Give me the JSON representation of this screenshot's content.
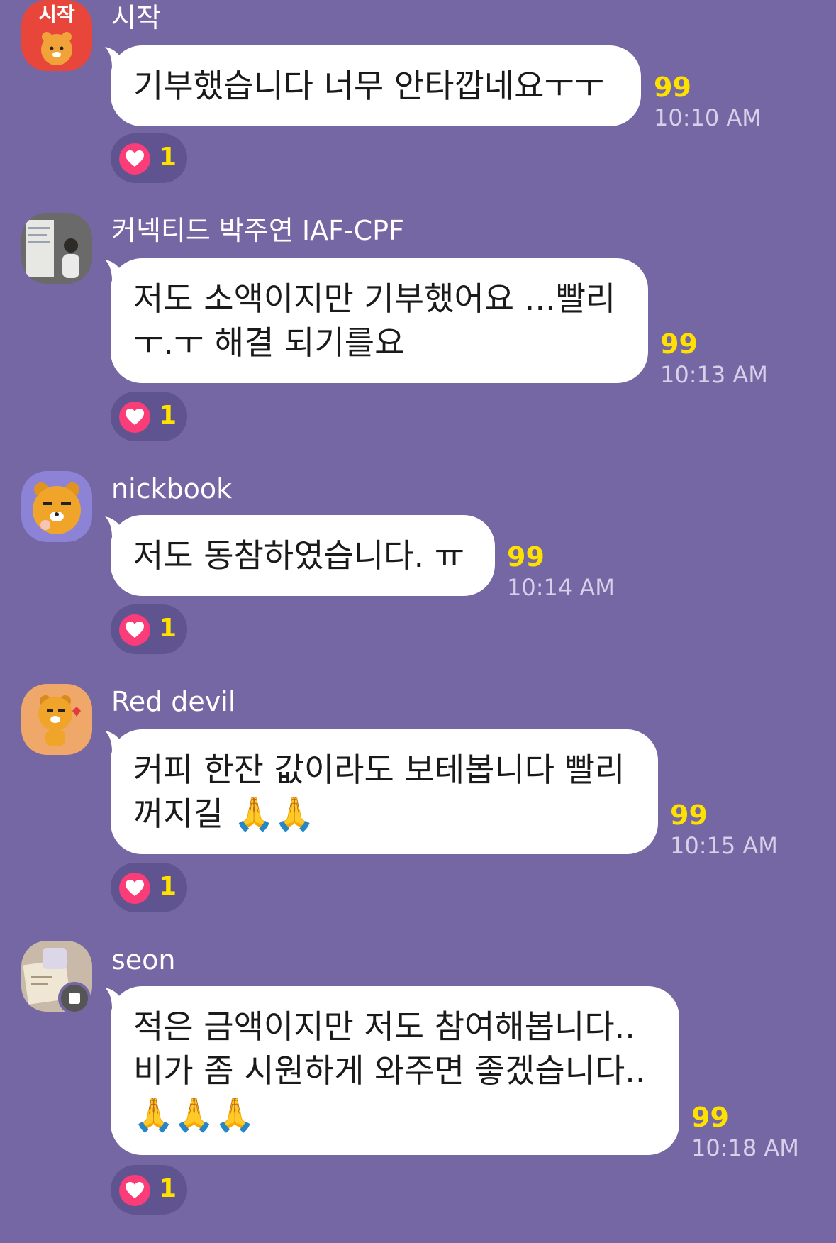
{
  "colors": {
    "background": "#7467a3",
    "bubble": "#ffffff",
    "unread": "#ffe100",
    "heart": "#fa3d78"
  },
  "messages": [
    {
      "sender": "시작",
      "avatar_text": "시작",
      "text": "기부했습니다 너무 안타깝네요ㅜㅜ",
      "unread": "99",
      "time": "10:10 AM",
      "reaction_icon": "heart-icon",
      "reaction_count": "1"
    },
    {
      "sender": "커넥티드 박주연 IAF-CPF",
      "text": "저도 소액이지만 기부했어요 ...빨리\nㅜ.ㅜ 해결 되기를요",
      "unread": "99",
      "time": "10:13 AM",
      "reaction_icon": "heart-icon",
      "reaction_count": "1"
    },
    {
      "sender": "nickbook",
      "text": "저도 동참하였습니다. ㅠ",
      "unread": "99",
      "time": "10:14 AM",
      "reaction_icon": "heart-icon",
      "reaction_count": "1"
    },
    {
      "sender": "Red devil",
      "text": "커피 한잔 값이라도 보테봅니다 빨리\n꺼지길 🙏🙏",
      "unread": "99",
      "time": "10:15 AM",
      "reaction_icon": "heart-icon",
      "reaction_count": "1"
    },
    {
      "sender": "seon",
      "text": "적은 금액이지만 저도 참여해봅니다..\n비가 좀 시원하게 와주면 좋겠습니다..\n🙏🙏🙏",
      "unread": "99",
      "time": "10:18 AM",
      "reaction_icon": "heart-icon",
      "reaction_count": "1"
    }
  ]
}
